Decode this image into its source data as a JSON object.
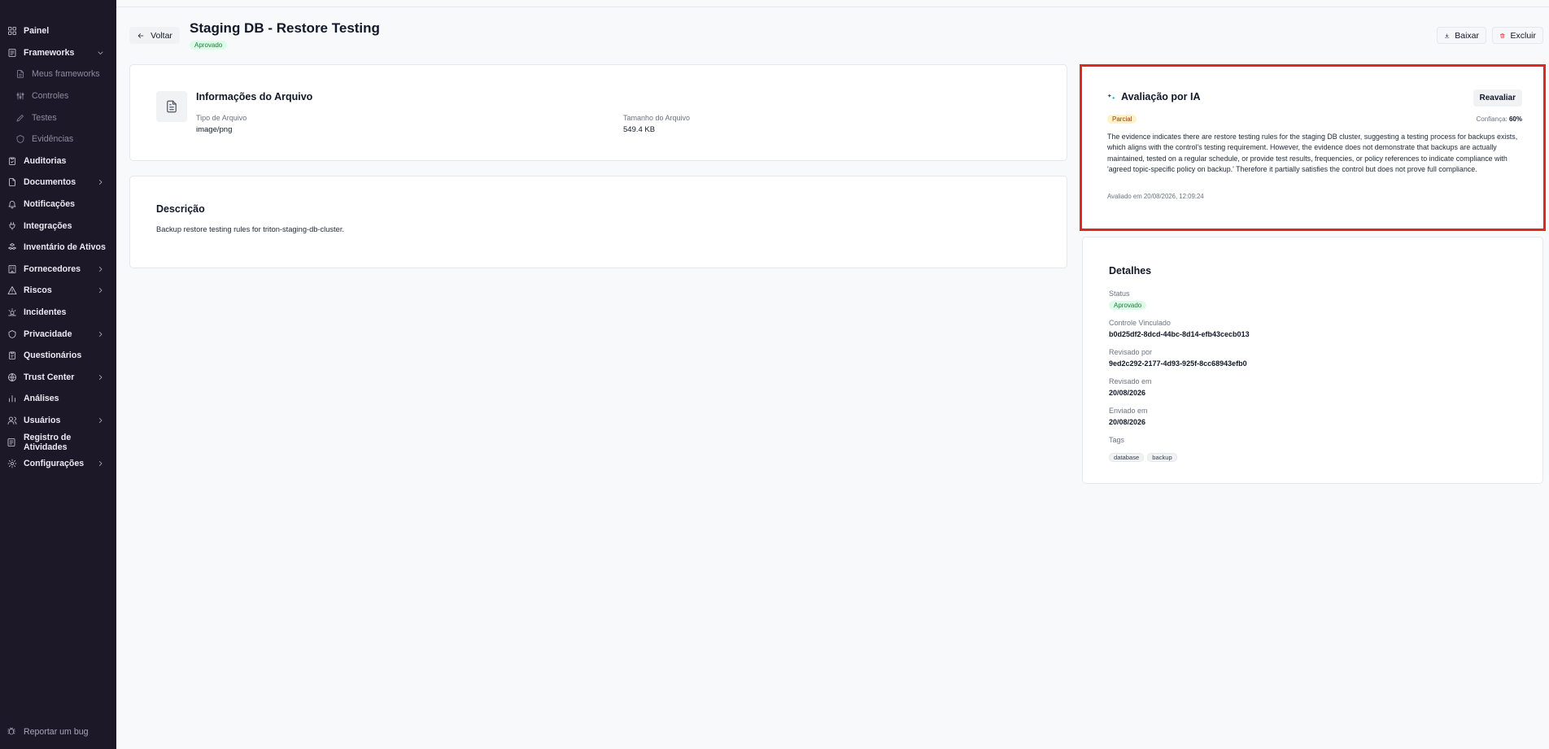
{
  "sidebar": {
    "items": [
      {
        "label": "Painel",
        "icon": "dashboard-icon",
        "chevron": ""
      },
      {
        "label": "Frameworks",
        "icon": "frameworks-icon",
        "chevron": "down"
      },
      {
        "label": "Meus frameworks",
        "icon": "file-icon",
        "chevron": "",
        "sub": true
      },
      {
        "label": "Controles",
        "icon": "sliders-icon",
        "chevron": "",
        "sub": true
      },
      {
        "label": "Testes",
        "icon": "pencil-icon",
        "chevron": "",
        "sub": true
      },
      {
        "label": "Evidências",
        "icon": "circle-icon",
        "chevron": "",
        "sub": true
      },
      {
        "label": "Auditorias",
        "icon": "clipboard-check-icon",
        "chevron": ""
      },
      {
        "label": "Documentos",
        "icon": "document-icon",
        "chevron": "right"
      },
      {
        "label": "Notificações",
        "icon": "bell-icon",
        "chevron": ""
      },
      {
        "label": "Integrações",
        "icon": "plug-icon",
        "chevron": ""
      },
      {
        "label": "Inventário de Ativos",
        "icon": "boxes-icon",
        "chevron": ""
      },
      {
        "label": "Fornecedores",
        "icon": "building-icon",
        "chevron": "right"
      },
      {
        "label": "Riscos",
        "icon": "warning-icon",
        "chevron": "right"
      },
      {
        "label": "Incidentes",
        "icon": "alert-sun-icon",
        "chevron": ""
      },
      {
        "label": "Privacidade",
        "icon": "shield-icon",
        "chevron": "right"
      },
      {
        "label": "Questionários",
        "icon": "clipboard-list-icon",
        "chevron": ""
      },
      {
        "label": "Trust Center",
        "icon": "globe-icon",
        "chevron": "right"
      },
      {
        "label": "Análises",
        "icon": "bar-chart-icon",
        "chevron": ""
      },
      {
        "label": "Usuários",
        "icon": "users-icon",
        "chevron": "right"
      },
      {
        "label": "Registro de Atividades",
        "icon": "log-icon",
        "chevron": ""
      },
      {
        "label": "Configurações",
        "icon": "gear-icon",
        "chevron": "right"
      }
    ],
    "bug_label": "Reportar um bug"
  },
  "header": {
    "back_label": "Voltar",
    "title": "Staging DB - Restore Testing",
    "status": "Aprovado",
    "download_label": "Baixar",
    "delete_label": "Excluir"
  },
  "file_info": {
    "title": "Informações do Arquivo",
    "type_label": "Tipo de Arquivo",
    "type_value": "image/png",
    "size_label": "Tamanho do Arquivo",
    "size_value": "549.4 KB"
  },
  "description": {
    "title": "Descrição",
    "text": "Backup restore testing rules for triton-staging-db-cluster."
  },
  "ai": {
    "title": "Avaliação por IA",
    "reevaluate_label": "Reavaliar",
    "verdict": "Parcial",
    "confidence_label": "Confiança:",
    "confidence_value": "60%",
    "text": "The evidence indicates there are restore testing rules for the staging DB cluster, suggesting a testing process for backups exists, which aligns with the control's testing requirement. However, the evidence does not demonstrate that backups are actually maintained, tested on a regular schedule, or provide test results, frequencies, or policy references to indicate compliance with 'agreed topic-specific policy on backup.' Therefore it partially satisfies the control but does not prove full compliance.",
    "evaluated_at": "Avaliado em 20/08/2026, 12:09:24",
    "highlight_color": "#e5261c"
  },
  "details": {
    "title": "Detalhes",
    "status_label": "Status",
    "status_value": "Aprovado",
    "control_label": "Controle Vinculado",
    "control_value": "b0d25df2-8dcd-44bc-8d14-efb43cecb013",
    "reviewed_by_label": "Revisado por",
    "reviewed_by_value": "9ed2c292-2177-4d93-925f-8cc68943efb0",
    "reviewed_at_label": "Revisado em",
    "reviewed_at_value": "20/08/2026",
    "submitted_label": "Enviado em",
    "submitted_value": "20/08/2026",
    "tags_label": "Tags",
    "tags": [
      "database",
      "backup"
    ]
  },
  "colors": {
    "sidebar_bg": "#1d1828",
    "approved_bg": "#dcfce7",
    "approved_fg": "#15803d",
    "partial_bg": "#fef3c7",
    "partial_fg": "#92400e",
    "danger": "#dc2626"
  }
}
